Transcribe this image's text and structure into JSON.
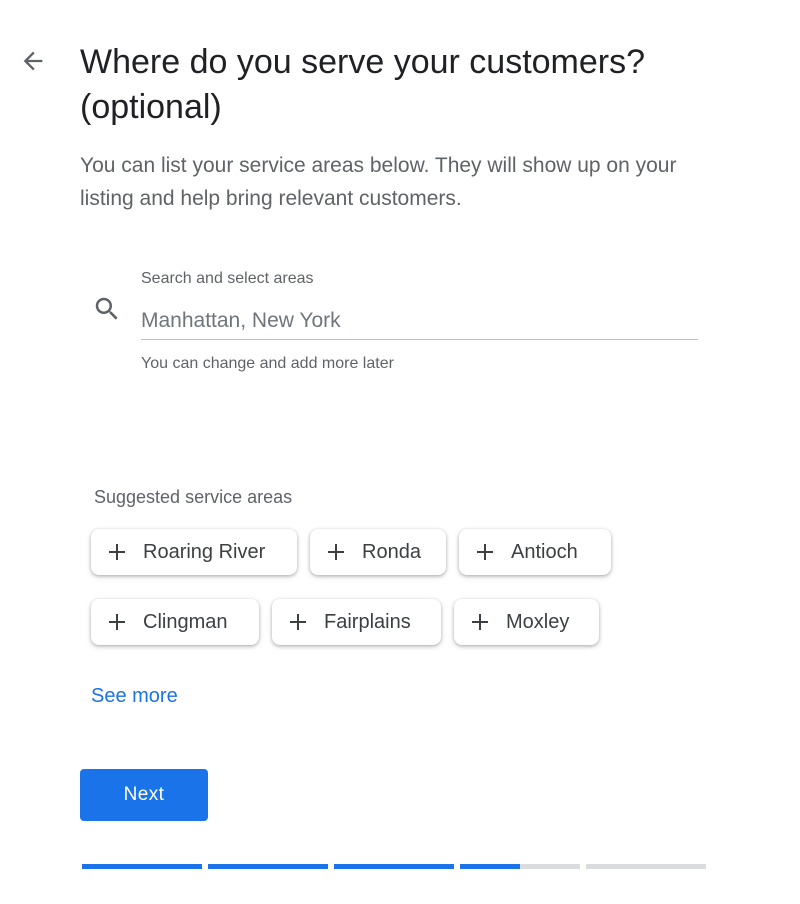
{
  "header": {
    "back_icon": "arrow-back-icon",
    "title": "Where do you serve your customers? (optional)",
    "subtitle": "You can list your service areas below. They will show up on your listing and help bring relevant customers."
  },
  "search": {
    "icon": "search-icon",
    "label": "Search and select areas",
    "placeholder": "Manhattan, New York",
    "value": "",
    "helper": "You can change and add more later"
  },
  "suggestions": {
    "heading": "Suggested service areas",
    "chip_icon": "plus-icon",
    "chips": [
      {
        "label": "Roaring River"
      },
      {
        "label": "Ronda"
      },
      {
        "label": "Antioch"
      },
      {
        "label": "Clingman"
      },
      {
        "label": "Fairplains"
      },
      {
        "label": "Moxley"
      }
    ],
    "see_more": "See more"
  },
  "actions": {
    "next_label": "Next"
  },
  "progress": {
    "segments": [
      1,
      1,
      1,
      0.5,
      0
    ]
  },
  "colors": {
    "accent": "#1a73e8",
    "track": "#dadce0",
    "text_primary": "#202124",
    "text_secondary": "#5f6368"
  }
}
